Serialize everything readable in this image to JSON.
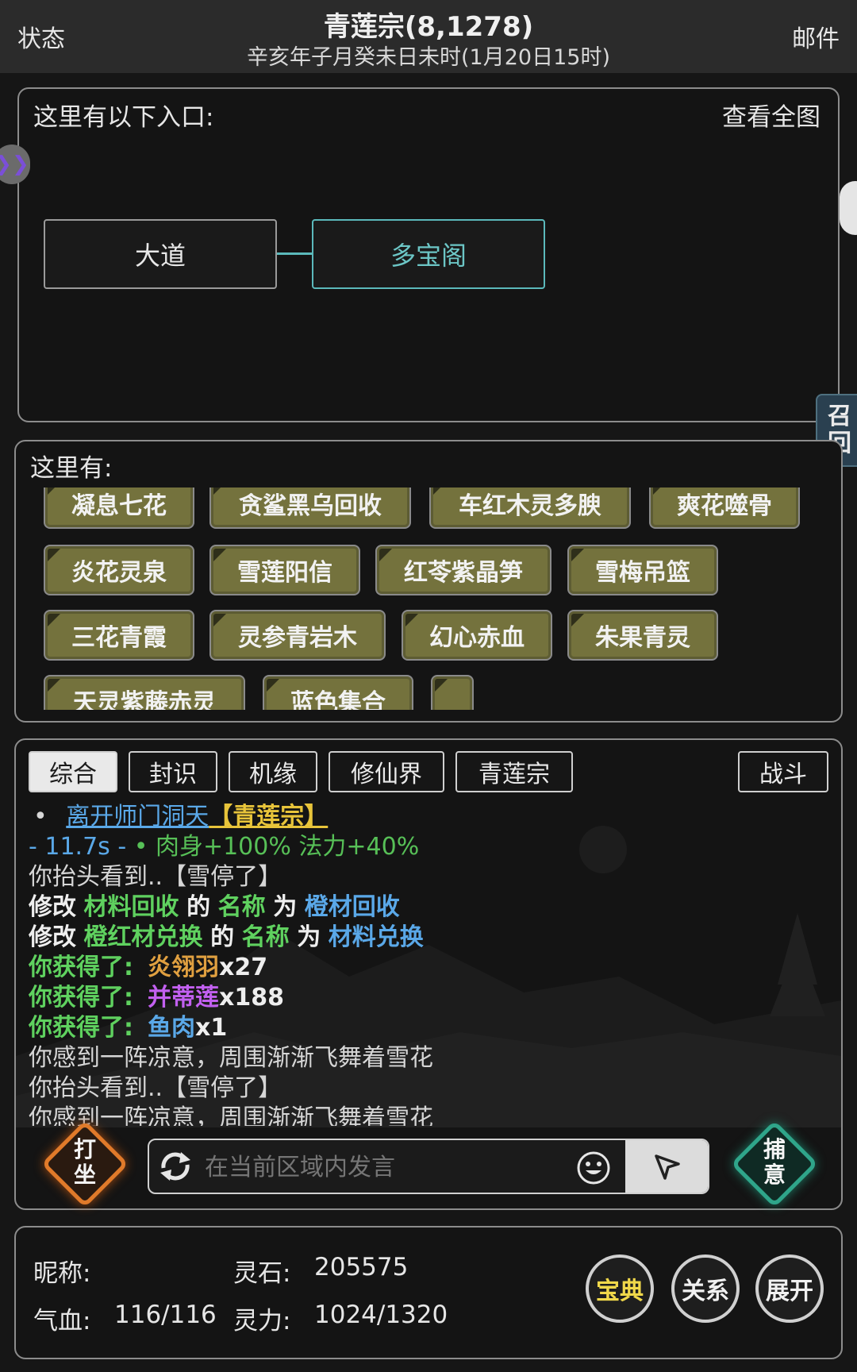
{
  "header": {
    "left_label": "状态",
    "title": "青莲宗(8,1278)",
    "subtitle": "辛亥年子月癸未日未时(1月20日15时)",
    "right_label": "邮件"
  },
  "entrances": {
    "title": "这里有以下入口:",
    "map_link": "查看全图",
    "nodes": [
      "大道",
      "多宝阁"
    ]
  },
  "recall_tab": [
    "召",
    "回"
  ],
  "here": {
    "title": "这里有:",
    "items": [
      "凝息七花",
      "贪鲨黑乌回收",
      "车红木灵多腴",
      "爽花噬骨",
      "炎花灵泉",
      "雪莲阳信",
      "红苓紫晶笋",
      "雪梅吊篮",
      "三花青霞",
      "灵参青岩木",
      "幻心赤血",
      "朱果青灵",
      "天灵紫藤赤灵",
      "蓝色集合",
      ""
    ]
  },
  "log": {
    "tabs": [
      "综合",
      "封识",
      "机缘",
      "修仙界",
      "青莲宗"
    ],
    "battle_tab": "战斗",
    "lines": {
      "l0_bullet": "•",
      "l0_link": "离开师门洞天",
      "l0_place": "【青莲宗】",
      "l1_time": "- 11.7s -",
      "l1_bullet": "•",
      "l1_buff": "肉身+100% 法力+40%",
      "l2": "你抬头看到..【雪停了】",
      "l3_a": "修改",
      "l3_b": "材料回收",
      "l3_c": "的",
      "l3_d": "名称",
      "l3_e": "为",
      "l3_f": "橙材回收",
      "l4_a": "修改",
      "l4_b": "橙红材兑换",
      "l4_c": "的",
      "l4_d": "名称",
      "l4_e": "为",
      "l4_f": "材料兑换",
      "l5_a": "你获得了:",
      "l5_b": "炎翎羽",
      "l5_c": "x27",
      "l6_a": "你获得了:",
      "l6_b": "并蒂莲",
      "l6_c": "x188",
      "l7_a": "你获得了:",
      "l7_b": "鱼肉",
      "l7_c": "x1",
      "l8": "你感到一阵凉意，周围渐渐飞舞着雪花",
      "l9": "你抬头看到..【雪停了】",
      "l10": "你感到一阵凉意，周围渐渐飞舞着雪花"
    }
  },
  "actions": {
    "meditate": [
      "打",
      "坐"
    ],
    "capture": [
      "捕",
      "意"
    ]
  },
  "chat": {
    "placeholder": "在当前区域内发言"
  },
  "stats": {
    "nickname_label": "昵称:",
    "nickname_value": "",
    "spirit_stone_label": "灵石:",
    "spirit_stone_value": "205575",
    "hp_label": "气血:",
    "hp_value": "116/116",
    "mana_label": "灵力:",
    "mana_value": "1024/1320"
  },
  "round_buttons": [
    "宝典",
    "关系",
    "展开"
  ],
  "colors": {
    "accent_teal": "#5bb9bb",
    "item_olive": "#74723d",
    "log_green": "#5fd15f",
    "log_blue": "#5aa8e8",
    "meditate_orange": "#e07a2a",
    "capture_teal": "#2fa58a"
  }
}
